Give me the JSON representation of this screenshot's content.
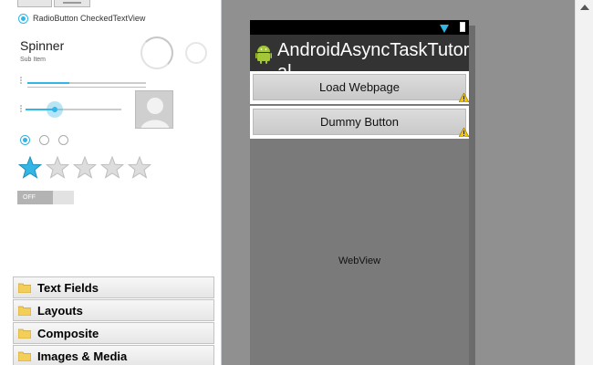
{
  "palette": {
    "radio_checked_label": "RadioButton  CheckedTextView",
    "spinner": {
      "title": "Spinner",
      "sub_item": "Sub Item"
    },
    "progress_fraction": 0.35,
    "seekbar_fraction": 0.3,
    "rating": {
      "filled": 1,
      "total": 5
    },
    "switch_state": "OFF",
    "categories": [
      "Text Fields",
      "Layouts",
      "Composite",
      "Images & Media"
    ]
  },
  "device": {
    "app_title": "AndroidAsyncTaskTutorial",
    "buttons": [
      "Load Webpage",
      "Dummy Button"
    ],
    "webview_label": "WebView"
  },
  "colors": {
    "accent": "#33b5e5",
    "canvas_bg": "#909090",
    "device_screen": "#7a7a7a",
    "title_bar": "#333333",
    "warning": "#f5c400"
  },
  "icons": [
    "folder-icon",
    "star-icon",
    "warning-icon",
    "android-icon",
    "wifi-icon",
    "battery-icon",
    "scroll-up-arrow-icon"
  ]
}
